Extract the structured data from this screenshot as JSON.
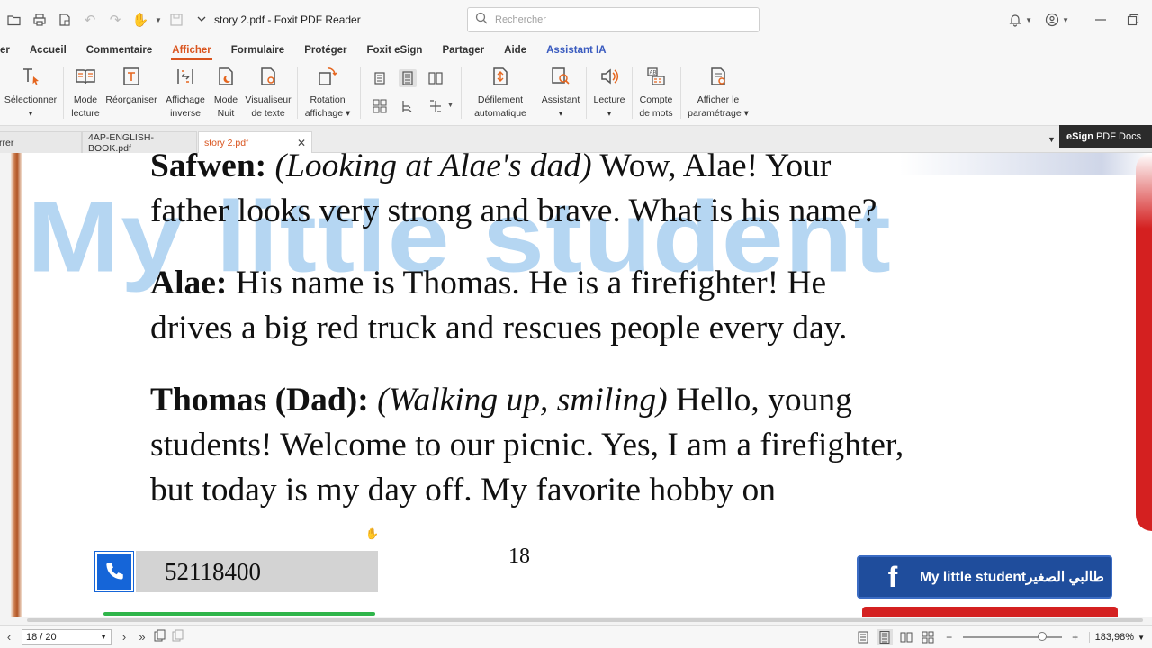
{
  "titlebar": {
    "title": "story 2.pdf - Foxit PDF Reader",
    "search_placeholder": "Rechercher"
  },
  "menu": {
    "tabs": [
      {
        "label": "er"
      },
      {
        "label": "Accueil"
      },
      {
        "label": "Commentaire"
      },
      {
        "label": "Afficher"
      },
      {
        "label": "Formulaire"
      },
      {
        "label": "Protéger"
      },
      {
        "label": "Foxit eSign"
      },
      {
        "label": "Partager"
      },
      {
        "label": "Aide"
      },
      {
        "label": "Assistant IA"
      }
    ],
    "active": "Afficher"
  },
  "ribbon": {
    "select": {
      "line1": "Sélectionner",
      "line2": "▾"
    },
    "reading": {
      "line1": "Mode",
      "line2": "lecture"
    },
    "reorganize": {
      "line1": "Réorganiser",
      "line2": ""
    },
    "inverse": {
      "line1": "Affichage",
      "line2": "inverse"
    },
    "night": {
      "line1": "Mode",
      "line2": "Nuit"
    },
    "textviewer": {
      "line1": "Visualiseur",
      "line2": "de texte"
    },
    "rotation": {
      "line1": "Rotation",
      "line2": "affichage ▾"
    },
    "autoscroll": {
      "line1": "Défilement",
      "line2": "automatique"
    },
    "assistant": {
      "line1": "Assistant",
      "line2": "▾"
    },
    "lecture": {
      "line1": "Lecture",
      "line2": "▾"
    },
    "wordcount": {
      "line1": "Compte",
      "line2": "de mots"
    },
    "settings": {
      "line1": "Afficher le",
      "line2": "paramétrage ▾"
    }
  },
  "doctabs": {
    "items": [
      {
        "label": "rrer"
      },
      {
        "label": "4AP-ENGLISH-BOOK.pdf"
      },
      {
        "label": "story 2.pdf"
      }
    ],
    "esign_bold": "eSign",
    "esign_rest": "PDF Docs"
  },
  "document": {
    "watermark": "My little student",
    "p1": {
      "speaker": "Safwen:",
      "direction": "(Looking at Alae's dad)",
      "line1_rest": "Wow, Alae! Your",
      "line2": "father looks very strong and brave. What is his name?"
    },
    "p2": {
      "speaker": "Alae:",
      "line1_rest": "His name is Thomas. He is a firefighter! He",
      "line2": "drives a big red truck and rescues people every day."
    },
    "p3": {
      "speaker": "Thomas (Dad):",
      "direction": "(Walking up, smiling)",
      "line1_rest": "Hello, young",
      "line2": "students! Welcome to our picnic. Yes, I am a firefighter,",
      "line3": "but today is my day off. My favorite hobby on"
    },
    "page_number": "18",
    "phone": "52118400",
    "facebook_letter": "f",
    "facebook_label": "My little studentطالبي الصغير"
  },
  "statusbar": {
    "page": "18 / 20",
    "zoom": "183,98%",
    "zoom_fraction": 0.8
  }
}
